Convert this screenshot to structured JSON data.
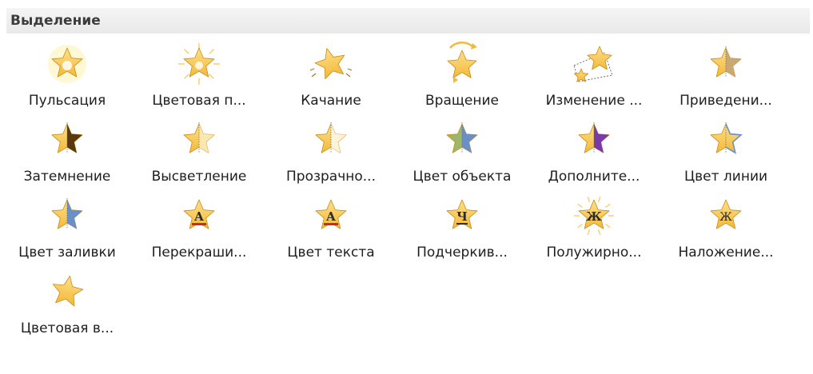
{
  "section": {
    "title": "Выделение"
  },
  "items": [
    {
      "label": "Пульсация",
      "icon": "pulse-star-icon"
    },
    {
      "label": "Цветовая п...",
      "icon": "color-pulse-star-icon"
    },
    {
      "label": "Качание",
      "icon": "teeter-star-icon"
    },
    {
      "label": "Вращение",
      "icon": "spin-star-icon"
    },
    {
      "label": "Изменение ...",
      "icon": "grow-shrink-star-icon"
    },
    {
      "label": "Приведени...",
      "icon": "desaturate-star-icon"
    },
    {
      "label": "Затемнение",
      "icon": "darken-star-icon"
    },
    {
      "label": "Высветление",
      "icon": "lighten-star-icon"
    },
    {
      "label": "Прозрачно...",
      "icon": "transparency-star-icon"
    },
    {
      "label": "Цвет объекта",
      "icon": "object-color-star-icon"
    },
    {
      "label": "Дополните...",
      "icon": "complementary-color-star-icon"
    },
    {
      "label": "Цвет линии",
      "icon": "line-color-star-icon"
    },
    {
      "label": "Цвет заливки",
      "icon": "fill-color-star-icon"
    },
    {
      "label": "Перекраши...",
      "icon": "brush-color-star-icon"
    },
    {
      "label": "Цвет текста",
      "icon": "font-color-star-icon"
    },
    {
      "label": "Подчеркив...",
      "icon": "underline-star-icon"
    },
    {
      "label": "Полужирно...",
      "icon": "bold-flash-star-icon"
    },
    {
      "label": "Наложение...",
      "icon": "bold-reveal-star-icon"
    },
    {
      "label": "Цветовая в...",
      "icon": "wave-star-icon"
    }
  ],
  "glyphs": {
    "font_letter": "A",
    "underline_letter": "Ч",
    "bold_letter": "Ж"
  },
  "colors": {
    "star_gold": "#f3b93a",
    "star_light": "#fde08a",
    "star_edge": "#c98a14",
    "glow": "#fff6c9",
    "dark_brown": "#5a3a0c",
    "blue": "#6b8fc7",
    "purple": "#7a3aa8",
    "red_bar": "#c0302b",
    "header_text": "#3c3c3c",
    "label_text": "#1e1e1e"
  }
}
